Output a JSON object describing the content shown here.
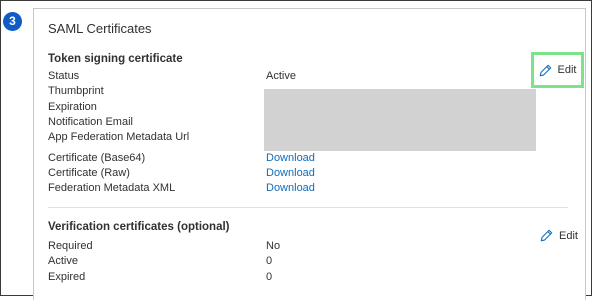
{
  "step": {
    "number": "3"
  },
  "section": {
    "title": "SAML Certificates"
  },
  "token_signing": {
    "heading": "Token signing certificate",
    "edit_label": "Edit",
    "status_label": "Status",
    "status_value": "Active",
    "thumbprint_label": "Thumbprint",
    "expiration_label": "Expiration",
    "notification_label": "Notification Email",
    "metadata_url_label": "App Federation Metadata Url",
    "cert_base64_label": "Certificate (Base64)",
    "cert_raw_label": "Certificate (Raw)",
    "federation_xml_label": "Federation Metadata XML",
    "download_label": "Download"
  },
  "verification": {
    "heading": "Verification certificates (optional)",
    "edit_label": "Edit",
    "required_label": "Required",
    "required_value": "No",
    "active_label": "Active",
    "active_value": "0",
    "expired_label": "Expired",
    "expired_value": "0"
  },
  "colors": {
    "accent_badge": "#0f5cc7",
    "link": "#0f6cbd",
    "highlight": "#7be38a",
    "redacted": "#d2d2d2"
  }
}
